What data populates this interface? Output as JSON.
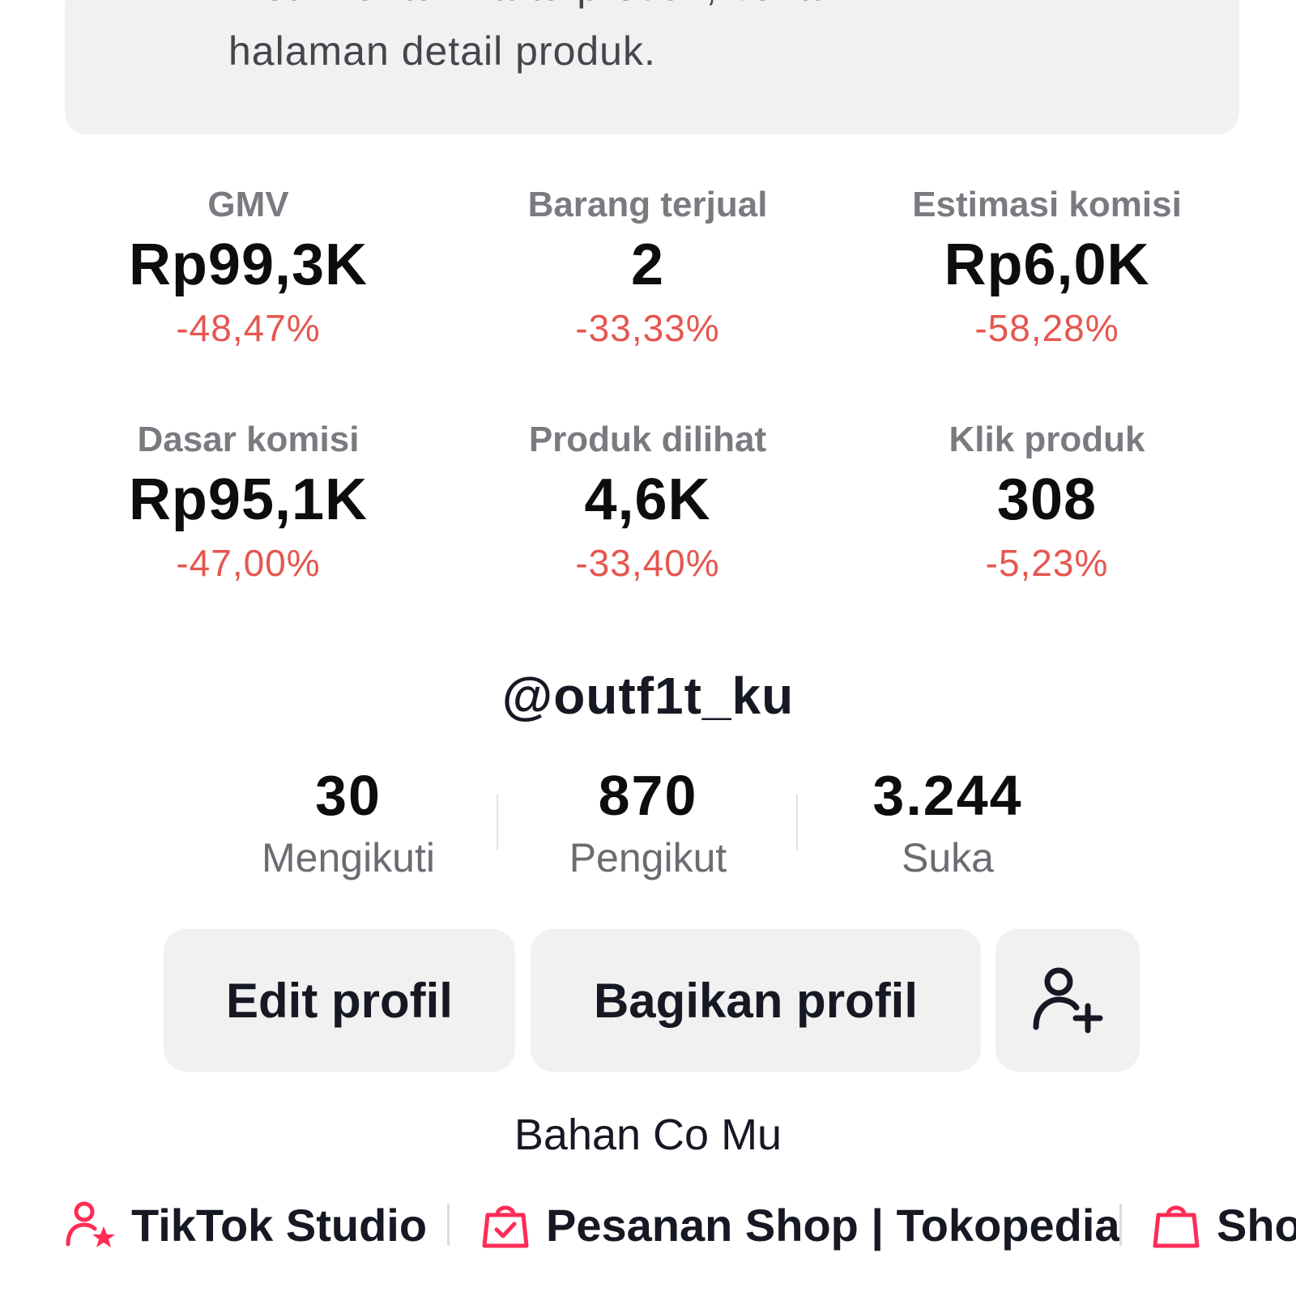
{
  "notice": {
    "line1": "metrik untuk kartu produk, bukan",
    "line2": "halaman detail produk."
  },
  "metrics": [
    {
      "label": "GMV",
      "value": "Rp99,3K",
      "change": "-48,47%"
    },
    {
      "label": "Barang terjual",
      "value": "2",
      "change": "-33,33%"
    },
    {
      "label": "Estimasi komisi",
      "value": "Rp6,0K",
      "change": "-58,28%"
    },
    {
      "label": "Dasar komisi",
      "value": "Rp95,1K",
      "change": "-47,00%"
    },
    {
      "label": "Produk dilihat",
      "value": "4,6K",
      "change": "-33,40%"
    },
    {
      "label": "Klik produk",
      "value": "308",
      "change": "-5,23%"
    }
  ],
  "profile": {
    "username": "@outf1t_ku",
    "stats": [
      {
        "value": "30",
        "label": "Mengikuti"
      },
      {
        "value": "870",
        "label": "Pengikut"
      },
      {
        "value": "3.244",
        "label": "Suka"
      }
    ],
    "bio": "Bahan Co Mu"
  },
  "actions": {
    "edit_label": "Edit profil",
    "share_label": "Bagikan profil",
    "add_friend_icon": "person-add-icon"
  },
  "links": [
    {
      "label": "TikTok Studio",
      "icon": "person-star-icon"
    },
    {
      "label": "Pesanan Shop | Tokopedia",
      "icon": "shopping-bag-check-icon"
    },
    {
      "label": "Shop",
      "icon": "shopping-bag-icon"
    }
  ],
  "colors": {
    "negative_change": "#e5574f",
    "accent_pink": "#fe2c55",
    "button_bg": "#f1f1f2"
  }
}
